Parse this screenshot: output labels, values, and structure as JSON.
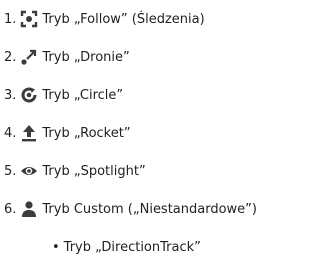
{
  "items": [
    {
      "number": "1.",
      "icon": "follow-icon",
      "label": "Tryb „Follow” (Śledzenia)"
    },
    {
      "number": "2.",
      "icon": "dronie-icon",
      "label": "Tryb „Dronie”"
    },
    {
      "number": "3.",
      "icon": "circle-icon",
      "label": "Tryb „Circle”"
    },
    {
      "number": "4.",
      "icon": "rocket-icon",
      "label": "Tryb „Rocket”"
    },
    {
      "number": "5.",
      "icon": "spotlight-icon",
      "label": "Tryb „Spotlight”"
    },
    {
      "number": "6.",
      "icon": "person-icon",
      "label": "Tryb Custom („Niestandardowe”)"
    }
  ],
  "sub_items": [
    {
      "bullet": "•",
      "label": "Tryb „DirectionTrack”"
    }
  ],
  "colors": {
    "text": "#222222",
    "icon": "#3c3c3c"
  }
}
